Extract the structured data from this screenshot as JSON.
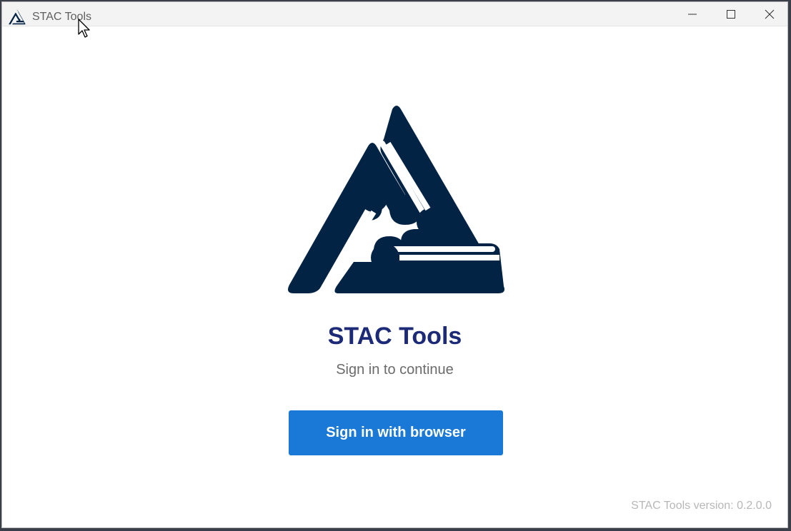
{
  "window": {
    "title": "STAC Tools",
    "controls": {
      "minimize": "minimize-icon",
      "maximize": "maximize-icon",
      "close": "close-icon"
    }
  },
  "main": {
    "app_name": "STAC Tools",
    "subtitle": "Sign in to continue",
    "signin_label": "Sign in with browser",
    "version_text": "STAC Tools version: 0.2.0.0"
  },
  "colors": {
    "logo": "#022344",
    "title": "#1c2a78",
    "button": "#1a78d6",
    "button_text": "#ffffff"
  }
}
